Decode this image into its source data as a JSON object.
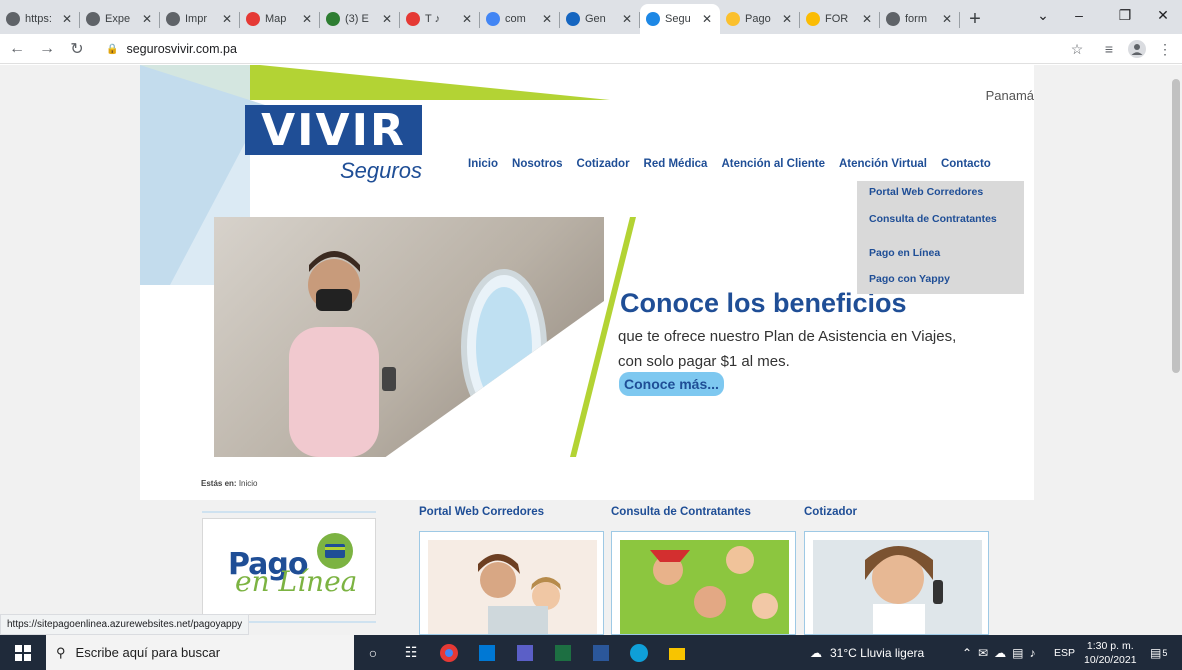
{
  "tabs": [
    {
      "title": "https:",
      "fav_color": "#5f6368",
      "active": false
    },
    {
      "title": "Expe",
      "fav_color": "#5f6368",
      "active": false
    },
    {
      "title": "Impr",
      "fav_color": "#5f6368",
      "active": false
    },
    {
      "title": "Map",
      "fav_color": "#e53935",
      "active": false
    },
    {
      "title": "(3) E",
      "fav_color": "#2e7d32",
      "active": false
    },
    {
      "title": "T ♪",
      "fav_color": "#e53935",
      "active": false
    },
    {
      "title": "com",
      "fav_color": "#4285f4",
      "active": false
    },
    {
      "title": "Gen",
      "fav_color": "#1565c0",
      "active": false
    },
    {
      "title": "Segu",
      "fav_color": "#1e88e5",
      "active": true
    },
    {
      "title": "Pago",
      "fav_color": "#fbc02d",
      "active": false
    },
    {
      "title": "FOR",
      "fav_color": "#fbbc04",
      "active": false
    },
    {
      "title": "form",
      "fav_color": "#5f6368",
      "active": false
    }
  ],
  "address_bar": {
    "url": "segurosvivir.com.pa"
  },
  "site": {
    "logo_main": "VIVIR",
    "logo_sub": "Seguros",
    "country": "Panamá",
    "nav": [
      "Inicio",
      "Nosotros",
      "Cotizador",
      "Red Médica",
      "Atención al Cliente",
      "Atención Virtual",
      "Contacto"
    ],
    "dropdown": [
      "Portal Web Corredores",
      "Consulta de Contratantes",
      "Pago en Línea",
      "Pago con Yappy"
    ],
    "hero": {
      "headline": "Conoce los beneficios",
      "text": "que te ofrece nuestro Plan de Asistencia en Viajes, con solo pagar $1 al mes.",
      "cta": "Conoce más..."
    },
    "breadcrumb_label": "Estás en:",
    "breadcrumb_value": "Inicio",
    "pago_word": "Pago",
    "pago_script": "en Línea",
    "columns": [
      "Portal Web Corredores",
      "Consulta de Contratantes",
      "Cotizador"
    ]
  },
  "status_url": "https://sitepagoenlinea.azurewebsites.net/pagoyappy",
  "taskbar": {
    "search_placeholder": "Escribe aquí para buscar",
    "weather": "31°C  Lluvia ligera",
    "lang": "ESP",
    "time": "1:30 p. m.",
    "date": "10/20/2021",
    "notifications": "5"
  },
  "colors": {
    "brand_blue": "#1f4e96",
    "brand_green": "#b3d334",
    "light_blue": "#c3dced"
  }
}
